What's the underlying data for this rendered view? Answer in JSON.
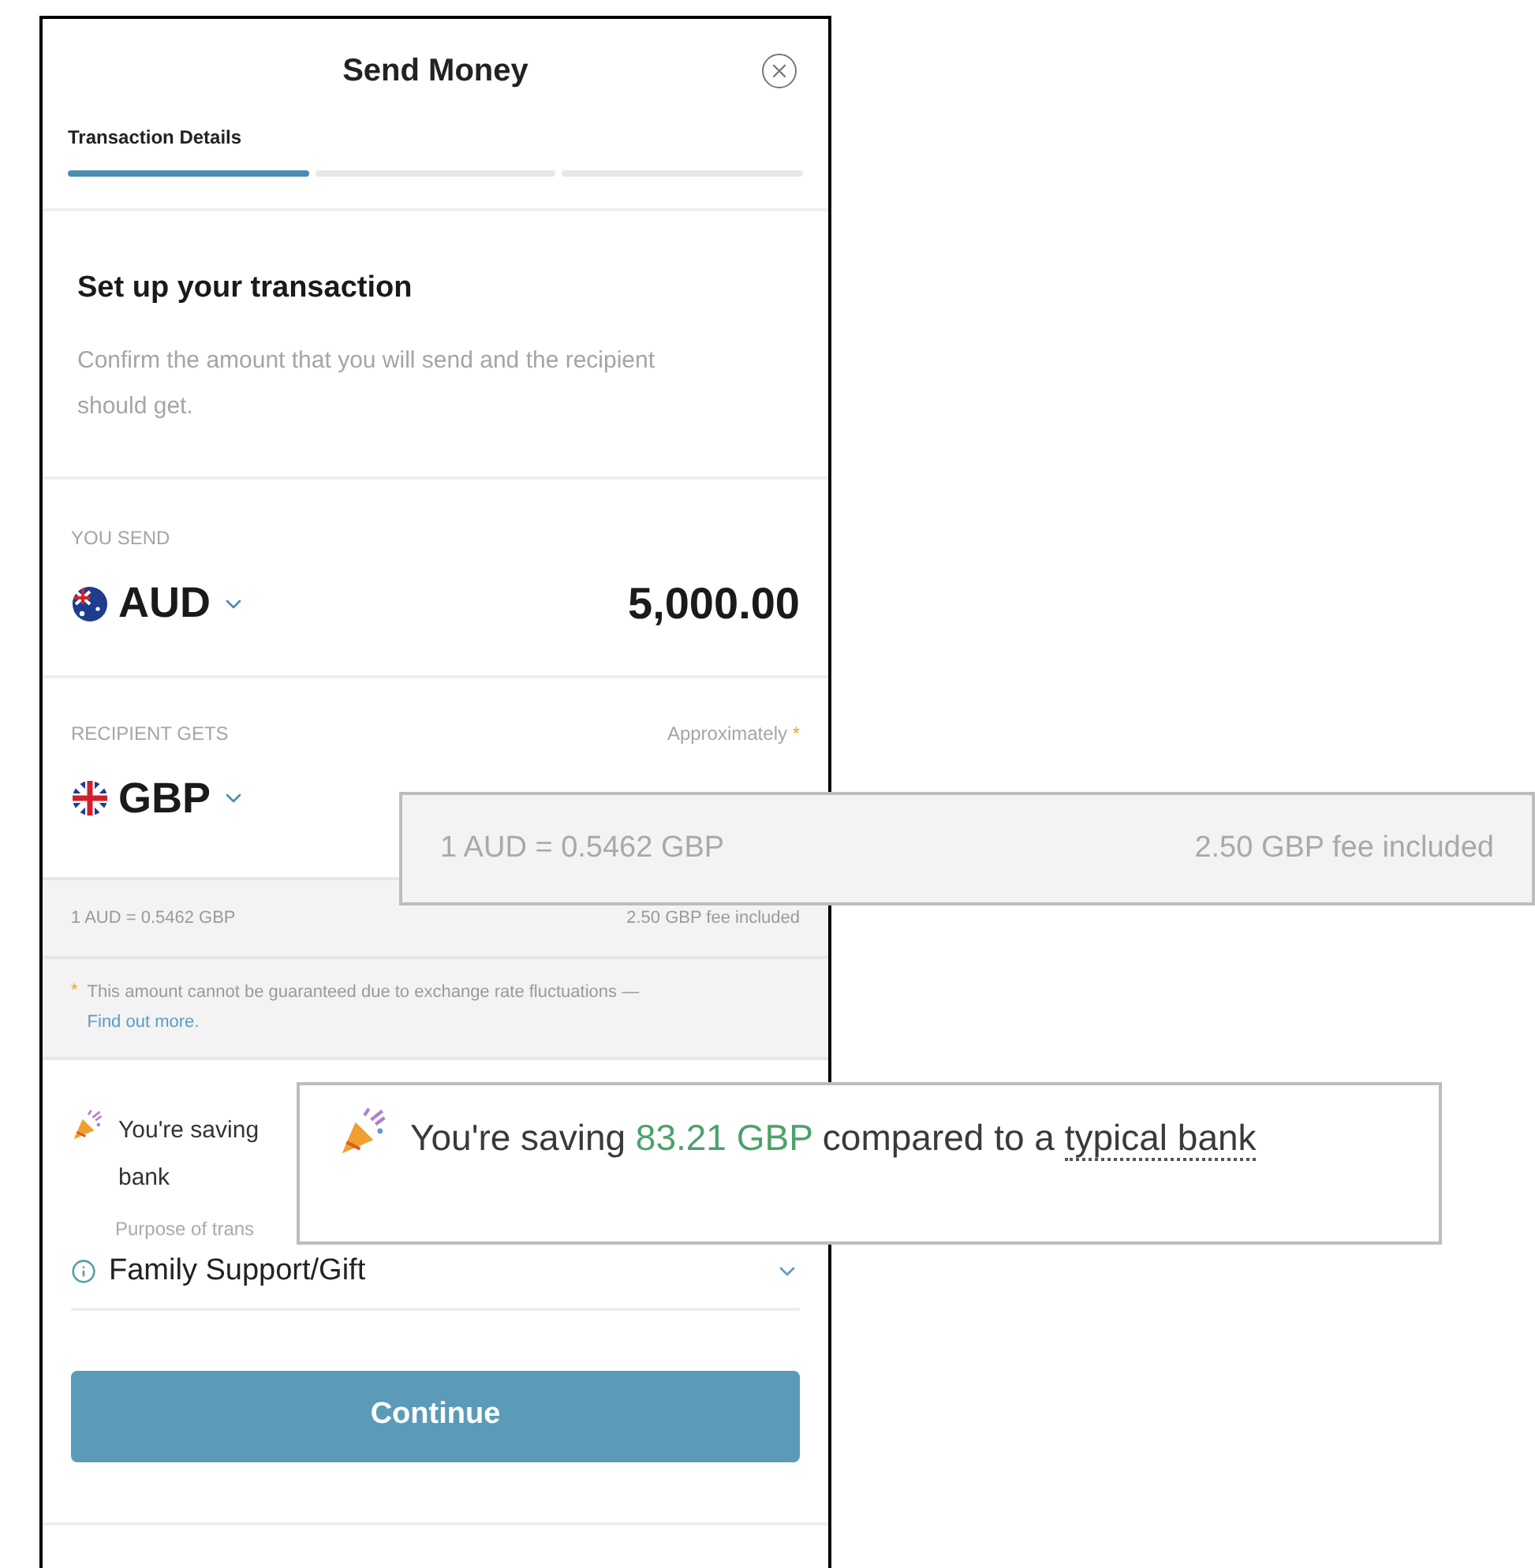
{
  "header": {
    "title": "Send Money"
  },
  "steps": [
    {
      "label": "Transaction Details",
      "selected": true
    },
    {
      "selected": false
    },
    {
      "selected": false
    }
  ],
  "intro": {
    "title": "Set up your transaction",
    "description": "Confirm the amount that you will send and the recipient should get."
  },
  "send": {
    "label": "YOU SEND",
    "currency": "AUD",
    "kind": "au",
    "amount": "5,000.00"
  },
  "receive": {
    "label": "RECIPIENT GETS",
    "note": "Approximately",
    "marker": "*",
    "currency": "GBP",
    "kind": "gb"
  },
  "rate": {
    "rate": "1 AUD = 0.5462 GBP",
    "fee": "2.50 GBP fee included"
  },
  "disclaimer": {
    "marker": "*",
    "text": "This amount cannot be guaranteed due to exchange rate fluctuations —",
    "link": "Find out more."
  },
  "saving": {
    "line1": "You're saving",
    "line2": "bank"
  },
  "purpose": {
    "label": "Purpose of trans",
    "value": "Family Support/Gift"
  },
  "continue_button": "Continue",
  "callouts": [
    {
      "kind": "rate",
      "rate": "1 AUD = 0.5462 GBP",
      "fee": "2.50 GBP fee included"
    },
    {
      "kind": "saving",
      "prefix": "You're saving",
      "amount": "83.21 GBP",
      "middle": "compared to a",
      "term": "typical bank"
    }
  ]
}
